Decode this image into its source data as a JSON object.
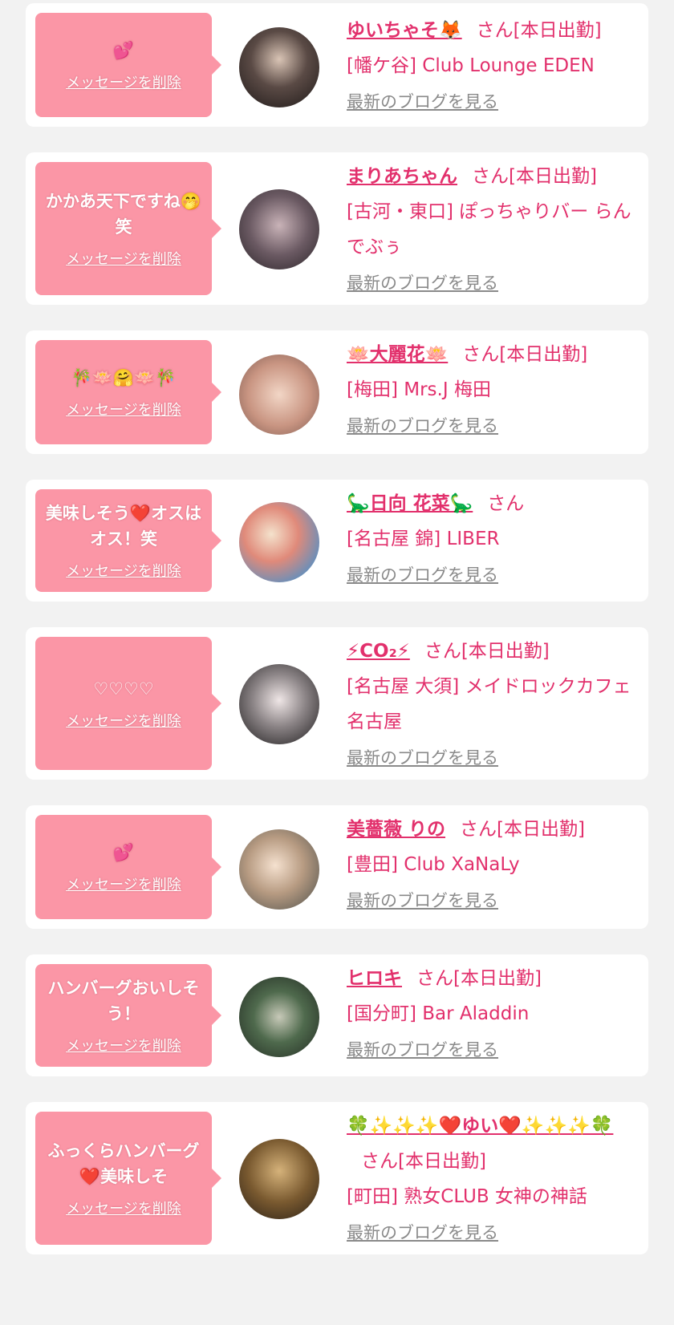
{
  "delete_label": "メッセージを削除",
  "blog_label": "最新のブログを見る",
  "cards": [
    {
      "message": "💕",
      "name": "ゆいちゃそ🦊",
      "status": "さん[本日出勤]",
      "shop": "[幡ケ谷] Club Lounge EDEN"
    },
    {
      "message": "かかあ天下ですね🤭笑",
      "name": "まりあちゃん",
      "status": "さん[本日出勤]",
      "shop": "[古河・東口] ぽっちゃりバー らんでぶぅ"
    },
    {
      "message": "🎋🪷🤗🪷🎋",
      "name": "🪷大麗花🪷",
      "status": "さん[本日出勤]",
      "shop": "[梅田] Mrs.J 梅田"
    },
    {
      "message": "美味しそう❤️オスはオス！笑",
      "name": "🦕日向 花菜🦕",
      "status": "さん",
      "shop": "[名古屋 錦] LIBER"
    },
    {
      "message": "♡♡♡♡",
      "name": "⚡CO₂⚡",
      "status": "さん[本日出勤]",
      "shop": "[名古屋 大須] メイドロックカフェ名古屋"
    },
    {
      "message": "💕",
      "name": "美薔薇 りの",
      "status": "さん[本日出勤]",
      "shop": "[豊田] Club XaNaLy"
    },
    {
      "message": "ハンバーグおいしそう！",
      "name": "ヒロキ",
      "status": "さん[本日出勤]",
      "shop": "[国分町] Bar Aladdin"
    },
    {
      "message": "ふっくらハンバーグ❤️美味しそ",
      "name": "🍀✨✨✨❤️ゆい❤️✨✨✨🍀",
      "status": "さん[本日出勤]",
      "shop": "[町田] 熟女CLUB 女神の神話"
    }
  ]
}
